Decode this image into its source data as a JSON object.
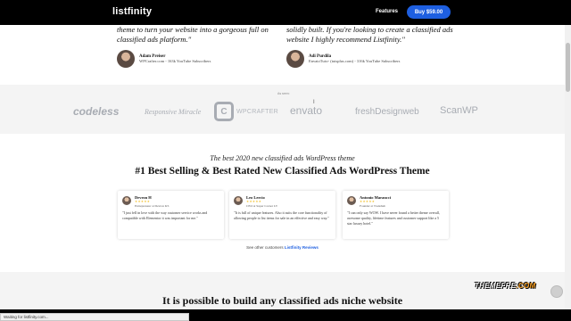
{
  "nav": {
    "logo": "listfinity",
    "features_label": "Features",
    "buy_label": "Buy $59.00"
  },
  "top_testimonials": [
    {
      "quote": "theme to turn your website into a gorgeous full on classified ads platform.\"",
      "name": "Adam Preiser",
      "subtitle": "WPCrafter.com - 163k YouTube Subscribers"
    },
    {
      "quote": "solidly built. If you're looking to create a classified ads website I highly recommend Listfinity.\"",
      "name": "Adi Purdila",
      "subtitle": "EnvatoTuts+ (tutsplus.com) - 316k YouTube Subscribers"
    }
  ],
  "logos_band": {
    "label": "As seen:",
    "brands": [
      "codeless",
      "Responsive Miracle",
      "WPCRAFTER",
      "envato",
      "freshDesignweb",
      "ScanWP"
    ]
  },
  "section": {
    "tagline": "The best 2020 new classified ads WordPress theme",
    "headline": "#1 Best Selling & Best Rated New Classified Ads WordPress Theme"
  },
  "reviews": [
    {
      "name": "Devron H",
      "stars": "★★★★★",
      "role": "Entrepreneur at Devron KS",
      "text": "\"I just fell in love with the way customer service works and compatible with Elementor it was important for me.\""
    },
    {
      "name": "Leo Lercio",
      "stars": "★★★★★",
      "role": "CEO at Super Corner LV",
      "text": "\"It is full of unique features. Also it suits the core functionality of allowing people to list items for sale in an effective and easy way.\""
    },
    {
      "name": "Antonio Marancci",
      "stars": "★★★★★",
      "role": "Founder at Tradehub",
      "text": "\"I can only say WOW. I have never found a better theme overall, awesome quality, lifetime features and customer support like a 5 star luxury hotel.\""
    }
  ],
  "see_other": {
    "prefix": "See other customers ",
    "link": "Listfinity Reviews"
  },
  "bottom_headline": "It is possible to build any classified ads niche website",
  "watermark": {
    "part1": "THEMEFRE",
    "part2": ".COM"
  },
  "status_bar": "Waiting for listfinity.com..."
}
